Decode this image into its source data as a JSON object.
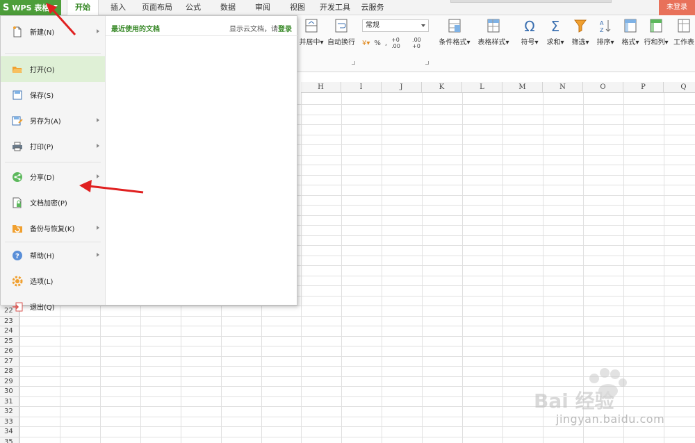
{
  "app": {
    "logo_label": "WPS 表格",
    "login_label": "未登录"
  },
  "tabs": [
    {
      "label": "开始"
    },
    {
      "label": "插入"
    },
    {
      "label": "页面布局"
    },
    {
      "label": "公式"
    },
    {
      "label": "数据"
    },
    {
      "label": "审阅"
    },
    {
      "label": "视图"
    },
    {
      "label": "开发工具"
    },
    {
      "label": "云服务"
    }
  ],
  "active_tab": "开始",
  "ribbon": {
    "merge_label": "并居中",
    "wrap_label": "自动换行",
    "number_format": "常规",
    "percent_symbol": "%",
    "comma_symbol": ",",
    "dec_inc": "+0 .00",
    "dec_dec": ".00 +0",
    "cond_format": "条件格式",
    "table_style": "表格样式",
    "symbol": "符号",
    "sum": "求和",
    "filter": "筛选",
    "sort": "排序",
    "format": "格式",
    "rowcol": "行和列",
    "worksheet": "工作表"
  },
  "columns": [
    "H",
    "I",
    "J",
    "K",
    "L",
    "M",
    "N",
    "O",
    "P",
    "Q"
  ],
  "rows": [
    "22",
    "23",
    "24",
    "25",
    "26",
    "27",
    "28",
    "29",
    "30",
    "31",
    "32",
    "33",
    "34",
    "35"
  ],
  "file_menu": {
    "items": [
      {
        "label": "新建(N)",
        "icon": "new-file-icon",
        "submenu": true
      },
      {
        "label": "打开(O)",
        "icon": "open-folder-icon",
        "submenu": false,
        "selected": true
      },
      {
        "label": "保存(S)",
        "icon": "save-icon",
        "submenu": false
      },
      {
        "label": "另存为(A)",
        "icon": "save-as-icon",
        "submenu": true
      },
      {
        "label": "打印(P)",
        "icon": "print-icon",
        "submenu": true
      },
      {
        "label": "分享(D)",
        "icon": "share-icon",
        "submenu": true
      },
      {
        "label": "文档加密(P)",
        "icon": "encrypt-icon",
        "submenu": false
      },
      {
        "label": "备份与恢复(K)",
        "icon": "backup-icon",
        "submenu": true
      },
      {
        "label": "帮助(H)",
        "icon": "help-icon",
        "submenu": true
      },
      {
        "label": "选项(L)",
        "icon": "options-gear-icon",
        "submenu": false
      },
      {
        "label": "退出(Q)",
        "icon": "exit-icon",
        "submenu": false
      }
    ],
    "recent_title": "最近使用的文档",
    "cloud_text": "显示云文档，请",
    "cloud_link": "登录"
  },
  "watermark": {
    "brand": "Bai 经验",
    "url": "jingyan.baidu.com"
  },
  "colors": {
    "wps_green": "#4d9e3a",
    "accent_green": "#3a8a2a",
    "selected_bg": "#dff0d6",
    "login_orange": "#e8715a",
    "arrow_red": "#e02020"
  }
}
